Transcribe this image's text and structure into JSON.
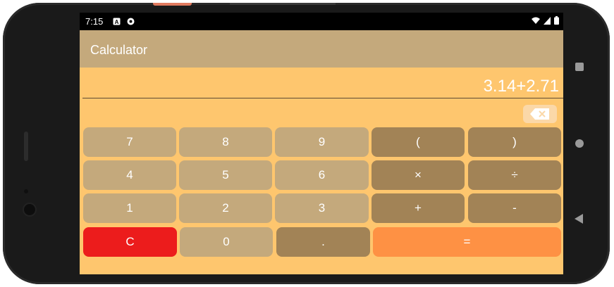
{
  "status": {
    "time": "7:15",
    "icons": [
      "a-notification-icon",
      "record-icon",
      "wifi-icon",
      "cell-signal-icon",
      "battery-icon"
    ]
  },
  "app": {
    "title": "Calculator"
  },
  "display": {
    "expression": "3.14+2.71"
  },
  "keypad": {
    "rows": [
      [
        "7",
        "8",
        "9",
        "(",
        ")"
      ],
      [
        "4",
        "5",
        "6",
        "×",
        "÷"
      ],
      [
        "1",
        "2",
        "3",
        "+",
        "-"
      ],
      [
        "C",
        "0",
        ".",
        "="
      ]
    ]
  },
  "colors": {
    "background": "#fec66e",
    "appbar": "#c4a97c",
    "digit_key": "#c4a97c",
    "operator_key": "#a28356",
    "clear_key": "#ec1c1c",
    "equals_key": "#fe9144",
    "backspace_key": "#fbd8a8"
  }
}
